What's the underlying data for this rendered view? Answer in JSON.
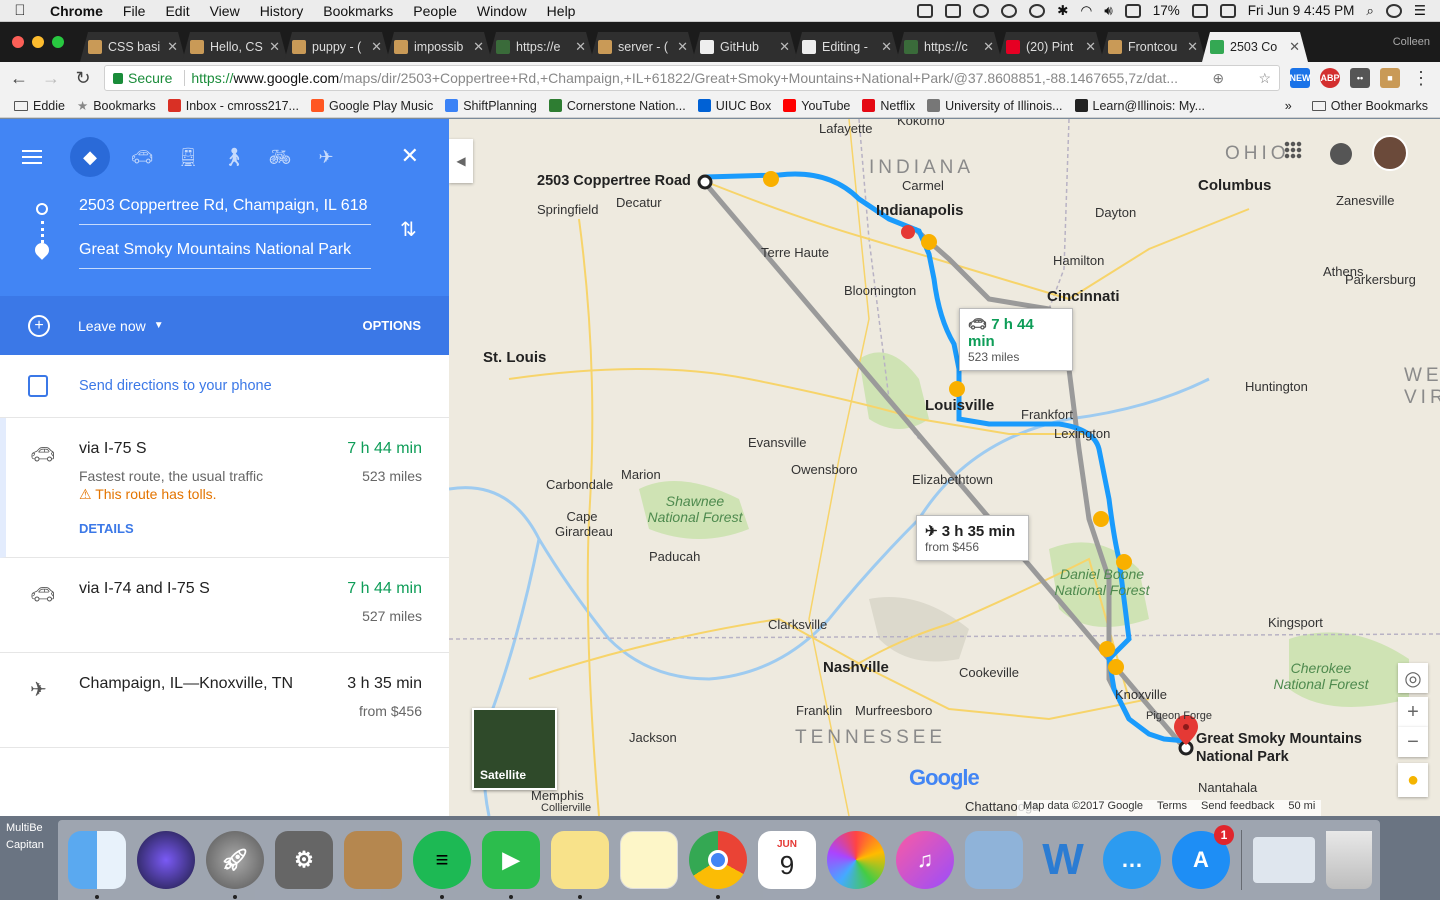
{
  "menubar": {
    "app": "Chrome",
    "menus": [
      "File",
      "Edit",
      "View",
      "History",
      "Bookmarks",
      "People",
      "Window",
      "Help"
    ],
    "battery": "17%",
    "clock": "Fri Jun 9  4:45 PM"
  },
  "tabs": [
    {
      "title": "CSS basi",
      "color": "#c99a57"
    },
    {
      "title": "Hello, CS",
      "color": "#c99a57"
    },
    {
      "title": "puppy - (",
      "color": "#c99a57"
    },
    {
      "title": "impossib",
      "color": "#c99a57"
    },
    {
      "title": "https://e",
      "color": "#3a6b3a"
    },
    {
      "title": "server - (",
      "color": "#c99a57"
    },
    {
      "title": "GitHub",
      "color": "#eeeeee"
    },
    {
      "title": "Editing -",
      "color": "#eeeeee"
    },
    {
      "title": "https://c",
      "color": "#3a6b3a"
    },
    {
      "title": "(20) Pint",
      "color": "#e60023"
    },
    {
      "title": "Frontcou",
      "color": "#c99a57"
    },
    {
      "title": "2503 Co",
      "color": "#34a853",
      "active": true
    }
  ],
  "profile": "Colleen",
  "toolbar": {
    "secure_label": "Secure",
    "url_scheme": "https://",
    "url_host": "www.google.com",
    "url_path": "/maps/dir/2503+Coppertree+Rd,+Champaign,+IL+61822/Great+Smoky+Mountains+National+Park/@37.8608851,-88.1467655,7z/dat..."
  },
  "bookmarks": [
    {
      "label": "Eddie",
      "type": "folder",
      "color": "#555555"
    },
    {
      "label": "Bookmarks",
      "type": "star",
      "color": "#888888"
    },
    {
      "label": "Inbox - cmross217...",
      "type": "mail",
      "color": "#d93025"
    },
    {
      "label": "Google Play Music",
      "type": "music",
      "color": "#ff5722"
    },
    {
      "label": "ShiftPlanning",
      "type": "app",
      "color": "#3b82f6"
    },
    {
      "label": "Cornerstone Nation...",
      "type": "app",
      "color": "#2e7d32"
    },
    {
      "label": "UIUC Box",
      "type": "app",
      "color": "#0061d5"
    },
    {
      "label": "YouTube",
      "type": "video",
      "color": "#ff0000"
    },
    {
      "label": "Netflix",
      "type": "app",
      "color": "#e50914"
    },
    {
      "label": "University of Illinois...",
      "type": "page",
      "color": "#777777"
    },
    {
      "label": "Learn@Illinois: My...",
      "type": "app",
      "color": "#222222"
    }
  ],
  "bookmarks_other": "Other Bookmarks",
  "directions": {
    "origin": "2503 Coppertree Rd, Champaign, IL 618",
    "destination": "Great Smoky Mountains National Park",
    "leave_now": "Leave now",
    "options": "OPTIONS",
    "send_label": "Send directions to your phone",
    "routes": [
      {
        "mode": "car-icon",
        "name": "via I-75 S",
        "time": "7 h 44 min",
        "distance": "523 miles",
        "desc": "Fastest route, the usual traffic",
        "warning": "This route has tolls.",
        "details": "DETAILS",
        "selected": true
      },
      {
        "mode": "car-icon",
        "name": "via I-74 and I-75 S",
        "time": "7 h 44 min",
        "distance": "527 miles"
      },
      {
        "mode": "plane-icon",
        "name": "Champaign, IL—Knoxville, TN",
        "time": "3 h 35 min",
        "distance": "from $456"
      }
    ]
  },
  "map": {
    "drive_box": {
      "time": "7 h 44 min",
      "distance": "523 miles"
    },
    "flight_box": {
      "time": "3 h 35 min",
      "price": "from $456"
    },
    "origin_label": "2503 Coppertree Road",
    "dest_label_1": "Great Smoky Mountains",
    "dest_label_2": "National Park",
    "states": [
      "INDIANA",
      "OHIO",
      "TENNESSEE",
      "WE",
      "VIRG"
    ],
    "cities": [
      "Indianapolis",
      "Louisville",
      "Cincinnati",
      "Lexington",
      "Nashville",
      "St. Louis",
      "Columbus",
      "Knoxville"
    ],
    "towns": [
      "Lafayette",
      "Kokomo",
      "Carmel",
      "Springfield",
      "Decatur",
      "Terre Haute",
      "Bloomington",
      "Dayton",
      "Hamilton",
      "Athens",
      "Parkersburg",
      "Zanesville",
      "Huntington",
      "Frankfort",
      "Evansville",
      "Owensboro",
      "Elizabethtown",
      "Marion",
      "Carbondale",
      "Cape Girardeau",
      "Paducah",
      "Clarksville",
      "Cookeville",
      "Franklin",
      "Murfreesboro",
      "Jackson",
      "Kingsport",
      "Pigeon Forge",
      "Collierville",
      "Memphis",
      "Chattanooga",
      "Nantahala",
      "Springfield",
      "Bloomington"
    ],
    "parks": [
      "Shawnee National Forest",
      "Daniel Boone National Forest",
      "Cherokee National Forest"
    ],
    "satellite_label": "Satellite",
    "attribution": [
      "Map data ©2017 Google",
      "Terms",
      "Send feedback",
      "50 mi"
    ],
    "route_color": "#1a9bfc",
    "alt_route_color": "#9a9a9a"
  },
  "dock": {
    "desktop_label_1": "MultiBe",
    "desktop_label_2": "Capitan",
    "calendar_month": "JUN",
    "calendar_day": "9",
    "appstore_badge": "1",
    "icons": [
      "finder-icon",
      "siri-icon",
      "launchpad-icon",
      "system-preferences-icon",
      "contacts-icon",
      "spotify-icon",
      "facetime-icon",
      "stickies-icon",
      "notes-icon",
      "chrome-icon",
      "calendar-icon",
      "photos-icon",
      "itunes-icon",
      "preview-icon",
      "word-icon",
      "messages-icon",
      "app-store-icon",
      "window-icon",
      "trash-icon"
    ]
  }
}
